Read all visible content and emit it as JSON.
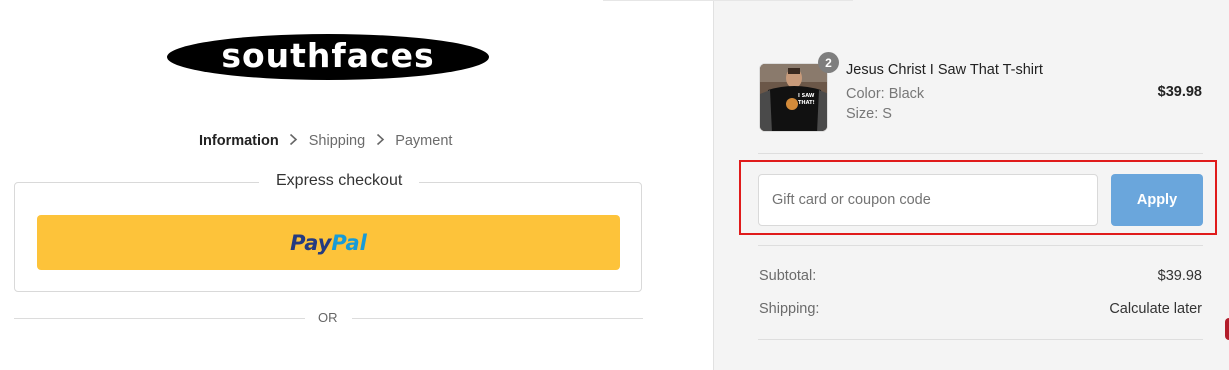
{
  "logo": {
    "text": "southfaces"
  },
  "breadcrumb": {
    "items": [
      "Information",
      "Shipping",
      "Payment"
    ],
    "separator": ">"
  },
  "express_checkout": {
    "title": "Express checkout",
    "paypal_part1": "Pay",
    "paypal_part2": "Pal",
    "paypal_color": "#fdc33a",
    "or_label": "OR"
  },
  "cart": {
    "item": {
      "name": "Jesus Christ I Saw That T-shirt",
      "color": "Color: Black",
      "size": "Size: S",
      "price": "$39.98",
      "quantity": "2",
      "thumb_text_top": "I SAW",
      "thumb_text_bottom": "THAT!"
    },
    "coupon": {
      "placeholder": "Gift card or coupon code",
      "apply_label": "Apply",
      "apply_color": "#6aa6dc",
      "highlight_color": "#e01b1b"
    },
    "summary": {
      "subtotal_label": "Subtotal:",
      "subtotal_value": "$39.98",
      "shipping_label": "Shipping:",
      "shipping_value": "Calculate later"
    }
  }
}
